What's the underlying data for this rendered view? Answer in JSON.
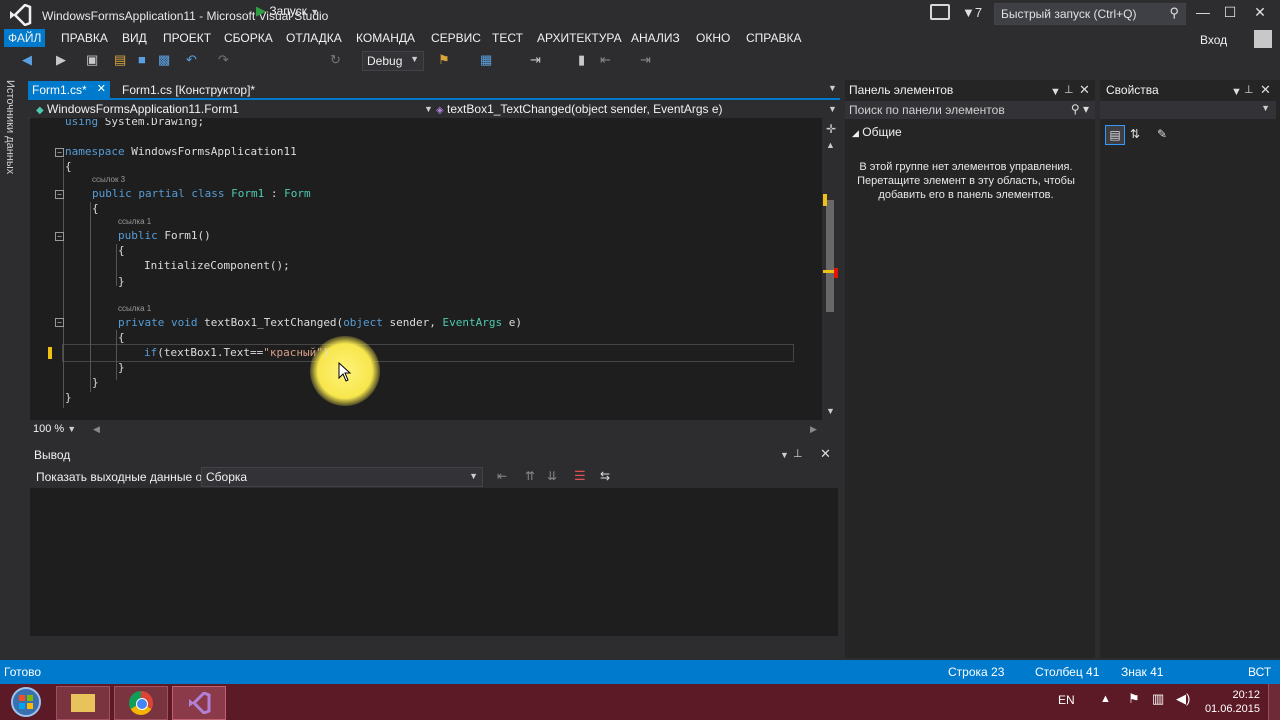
{
  "window": {
    "title": "WindowsFormsApplication11 - Microsoft Visual Studio",
    "notifications": "7",
    "quick_launch_placeholder": "Быстрый запуск (Ctrl+Q)",
    "signin": "Вход"
  },
  "menu": [
    "ФАЙЛ",
    "ПРАВКА",
    "ВИД",
    "ПРОЕКТ",
    "СБОРКА",
    "ОТЛАДКА",
    "КОМАНДА",
    "СЕРВИС",
    "ТЕСТ",
    "АРХИТЕКТУРА",
    "АНАЛИЗ",
    "ОКНО",
    "СПРАВКА"
  ],
  "toolbar": {
    "run_label": "Запуск",
    "config": "Debug"
  },
  "left_strip": {
    "label": "Источники данных"
  },
  "tabs": [
    {
      "label": "Form1.cs*",
      "active": true
    },
    {
      "label": "Form1.cs [Конструктор]*",
      "active": false
    }
  ],
  "navbar": {
    "left": "WindowsFormsApplication11.Form1",
    "right": "textBox1_TextChanged(object sender, EventArgs e)"
  },
  "code": {
    "lines": [
      {
        "text": "using System.Drawing;"
      },
      {
        "text": "namespace WindowsFormsApplication11"
      },
      {
        "text": "{"
      },
      {
        "lens": "ссылок 3"
      },
      {
        "text": "public partial class Form1 : Form"
      },
      {
        "text": "{"
      },
      {
        "lens": "ссылка 1"
      },
      {
        "text": "public Form1()"
      },
      {
        "text": "{"
      },
      {
        "text": "InitializeComponent();"
      },
      {
        "text": "}"
      },
      {
        "lens": "ссылка 1"
      },
      {
        "text": "private void textBox1_TextChanged(object sender, EventArgs e)"
      },
      {
        "text": "{"
      },
      {
        "text": "if(textBox1.Text==\"красный\")"
      },
      {
        "text": "}"
      },
      {
        "text": "}"
      },
      {
        "text": "}"
      }
    ]
  },
  "zoom": "100 %",
  "output": {
    "title": "Вывод",
    "show_label": "Показать выходные данные от:",
    "source": "Сборка"
  },
  "toolbox": {
    "title": "Панель элементов",
    "search_placeholder": "Поиск по панели элементов",
    "group": "Общие",
    "empty_line1": "В этой группе нет элементов управления.",
    "empty_line2": "Перетащите элемент в эту область, чтобы",
    "empty_line3": "добавить его в панель элементов."
  },
  "properties": {
    "title": "Свойства"
  },
  "status": {
    "ready": "Готово",
    "line": "Строка 23",
    "col": "Столбец 41",
    "ch": "Знак 41",
    "mode": "ВСТ"
  },
  "taskbar": {
    "lang": "EN",
    "time": "20:12",
    "date": "01.06.2015"
  },
  "colors": {
    "accent": "#007acc",
    "background": "#2d2d30",
    "editor": "#1e1e1e",
    "keyword": "#569cd6",
    "type": "#4ec9b0",
    "string": "#d69d85"
  }
}
